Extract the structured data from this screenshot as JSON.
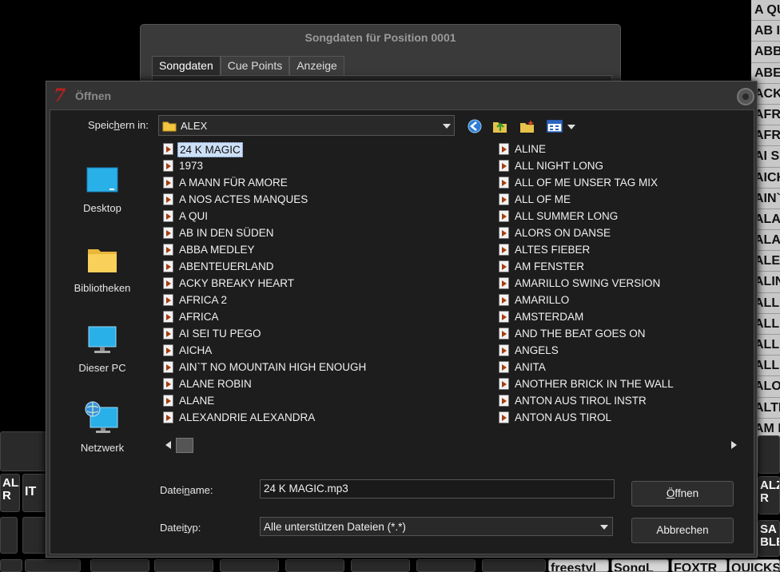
{
  "background": {
    "right_list": [
      "A QU",
      "AB IN",
      "ABBA",
      "ABEN",
      "ACKY",
      "AFRIC",
      "AFRIC",
      "AI SE",
      "AICHA",
      "AIN`T",
      "ALAN",
      "ALAN",
      "ALEX",
      "ALIN",
      "ALL N",
      "ALL O",
      "ALL O",
      "ALL S",
      "ALOR",
      "ALTE",
      "AM F"
    ],
    "keys": {
      "k1": "ALA\nR",
      "k2": "IT",
      "k3": "ALZ\nR",
      "k4": "SA\nBLE",
      "k5": "freestyl",
      "k6": "SongL",
      "k7": "FOXTR",
      "k8": "QUICKS"
    }
  },
  "song_window": {
    "title": "Songdaten für Position 0001",
    "tabs": [
      "Songdaten",
      "Cue Points",
      "Anzeige"
    ]
  },
  "open_dialog": {
    "title": "Öffnen",
    "look_in_label": {
      "pre": "Speic",
      "u": "h",
      "post": "ern in:"
    },
    "look_in_value": "ALEX",
    "places": [
      {
        "label": "Desktop",
        "icon": "desktop-icon"
      },
      {
        "label": "Bibliotheken",
        "icon": "libraries-icon"
      },
      {
        "label": "Dieser PC",
        "icon": "this-pc-icon"
      },
      {
        "label": "Netzwerk",
        "icon": "network-icon"
      }
    ],
    "files_col1": [
      "24 K MAGIC",
      "1973",
      "A MANN FÜR AMORE",
      "A NOS ACTES MANQUES",
      "A QUI",
      "AB IN DEN SÜDEN",
      "ABBA MEDLEY",
      "ABENTEUERLAND",
      "ACKY BREAKY HEART",
      "AFRICA 2",
      "AFRICA",
      "AI SEI TU PEGO",
      "AICHA",
      "AIN`T NO MOUNTAIN HIGH ENOUGH",
      "ALANE ROBIN",
      "ALANE",
      "ALEXANDRIE ALEXANDRA"
    ],
    "files_col2": [
      "ALINE",
      "ALL NIGHT LONG",
      "ALL OF ME UNSER TAG MIX",
      "ALL OF ME",
      "ALL SUMMER LONG",
      "ALORS ON DANSE",
      "ALTES FIEBER",
      "AM FENSTER",
      "AMARILLO SWING VERSION",
      "AMARILLO",
      "AMSTERDAM",
      "AND THE BEAT GOES ON",
      "ANGELS",
      "ANITA",
      "ANOTHER BRICK IN THE WALL",
      "ANTON AUS TIROL INSTR",
      "ANTON AUS TIROL"
    ],
    "selected_file": "24 K MAGIC",
    "filename_label": {
      "pre": "Datei",
      "u": "n",
      "post": "ame:"
    },
    "filename_value": "24 K MAGIC.mp3",
    "filetype_label": {
      "pre": "Datei",
      "u": "t",
      "post": "yp:"
    },
    "filetype_value": "Alle unterstützen Dateien (*.*)",
    "open_button": {
      "pre": "",
      "u": "Ö",
      "post": "ffnen"
    },
    "cancel_button": "Abbrechen"
  },
  "colors": {
    "accent": "#cde0f7",
    "app_icon": "#b62020"
  }
}
